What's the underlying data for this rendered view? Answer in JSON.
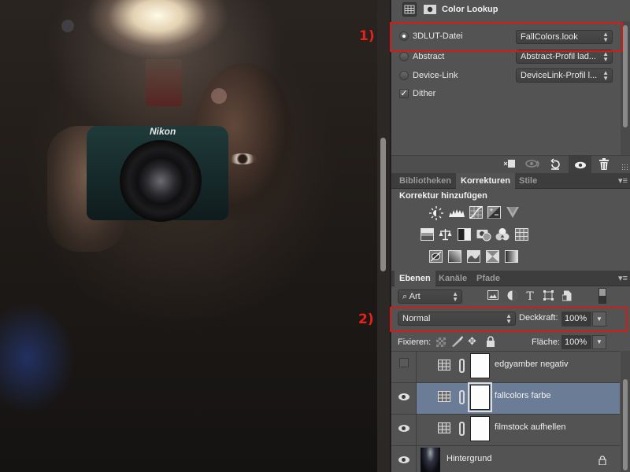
{
  "canvas": {
    "photo_description": "Self-portrait of a man holding a Nikon camera with flash firing",
    "camera_brand": "Nikon",
    "annotations": [
      "1)",
      "2)"
    ]
  },
  "properties_panel": {
    "title": "Color Lookup",
    "header_icons": [
      "adjustment-grid-icon",
      "mask-icon"
    ],
    "options": [
      {
        "label": "3DLUT-Datei",
        "selected": true,
        "dropdown_value": "FallColors.look"
      },
      {
        "label": "Abstract",
        "selected": false,
        "dropdown_value": "Abstract-Profil lad..."
      },
      {
        "label": "Device-Link",
        "selected": false,
        "dropdown_value": "DeviceLink-Profil l..."
      }
    ],
    "dither": {
      "label": "Dither",
      "checked": true
    },
    "footer_icons": [
      "clip-to-layer-icon",
      "view-previous-state-icon",
      "reset-icon",
      "visibility-icon",
      "trash-icon"
    ]
  },
  "adjustments_panel": {
    "tabs": [
      {
        "label": "Bibliotheken",
        "active": false
      },
      {
        "label": "Korrekturen",
        "active": true
      },
      {
        "label": "Stile",
        "active": false
      }
    ],
    "title": "Korrektur hinzufügen",
    "icon_rows": [
      [
        "brightness-contrast-icon",
        "levels-icon",
        "curves-icon",
        "exposure-icon",
        "vibrance-icon"
      ],
      [
        "hue-saturation-icon",
        "color-balance-icon",
        "black-white-icon",
        "photo-filter-icon",
        "channel-mixer-icon",
        "color-lookup-icon"
      ],
      [
        "invert-icon",
        "posterize-icon",
        "threshold-icon",
        "selective-color-icon",
        "gradient-map-icon"
      ]
    ]
  },
  "layers_panel": {
    "tabs": [
      {
        "label": "Ebenen",
        "active": true
      },
      {
        "label": "Kanäle",
        "active": false
      },
      {
        "label": "Pfade",
        "active": false
      }
    ],
    "filter_kind": "Art",
    "filter_icons": [
      "image-filter-icon",
      "adjustment-filter-icon",
      "type-filter-icon",
      "shape-filter-icon",
      "smart-object-filter-icon"
    ],
    "blend_mode": "Normal",
    "opacity_label": "Deckkraft:",
    "opacity_value": "100%",
    "lock_label": "Fixieren:",
    "fill_label": "Fläche:",
    "fill_value": "100%",
    "layers": [
      {
        "name": "edgyamber negativ",
        "visible": false,
        "type": "adjustment",
        "selected": false
      },
      {
        "name": "fallcolors farbe",
        "visible": true,
        "type": "adjustment",
        "selected": true
      },
      {
        "name": "filmstock aufhellen",
        "visible": true,
        "type": "adjustment",
        "selected": false
      },
      {
        "name": "Hintergrund",
        "visible": true,
        "type": "background",
        "locked": true,
        "selected": false
      }
    ]
  },
  "colors": {
    "panel_bg": "#535353",
    "selected_layer": "#6b7c96",
    "annotation_red": "#d41b17"
  }
}
